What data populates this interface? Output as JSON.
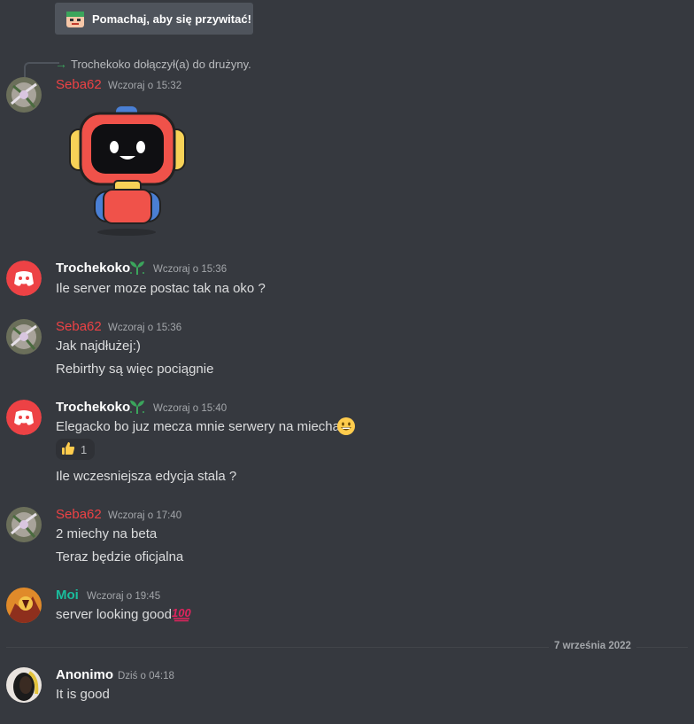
{
  "wave_button": {
    "label": "Pomachaj, aby się przywitać!",
    "icon": "wave-sticker-icon"
  },
  "system_message": {
    "text": "Trochekoko dołączył(a) do drużyny.",
    "icon": "join-arrow-icon"
  },
  "messages": [
    {
      "author": "Seba62",
      "timestamp": "Wczoraj o 15:32",
      "sticker": "robot-sticker"
    },
    {
      "author": "Trochekoko",
      "badge": "leaf-badge-icon",
      "timestamp": "Wczoraj o 15:36",
      "text": "Ile server moze postac tak na oko ?"
    },
    {
      "author": "Seba62",
      "timestamp": "Wczoraj o 15:36",
      "lines": [
        "Jak najdłużej:)",
        "Rebirthy są więc pociągnie"
      ]
    },
    {
      "author": "Trochekoko",
      "badge": "leaf-badge-icon",
      "timestamp": "Wczoraj o 15:40",
      "text": "Elegacko bo juz mecza mnie serwery na miecha",
      "emoji": "grinning-face-emoji",
      "reaction": {
        "emoji": "thumbs-up-emoji",
        "count": "1"
      },
      "followup": "Ile wczesniejsza edycja stala ?"
    },
    {
      "author": "Seba62",
      "timestamp": "Wczoraj o 17:40",
      "lines": [
        "2 miechy na beta",
        "Teraz będzie oficjalna"
      ]
    },
    {
      "author": "Moi",
      "timestamp": "Wczoraj o 19:45",
      "text": "server looking good",
      "emoji": "hundred-points-emoji"
    },
    {
      "author": "Anonimo",
      "timestamp": "Dziś o 04:18",
      "text": "It is good"
    }
  ],
  "date_divider": "7 września 2022",
  "colors": {
    "background": "#36393f",
    "seba_name": "#ed4245",
    "moi_name": "#1abc9c",
    "discord_blurple_avatar": "#ed4245"
  }
}
